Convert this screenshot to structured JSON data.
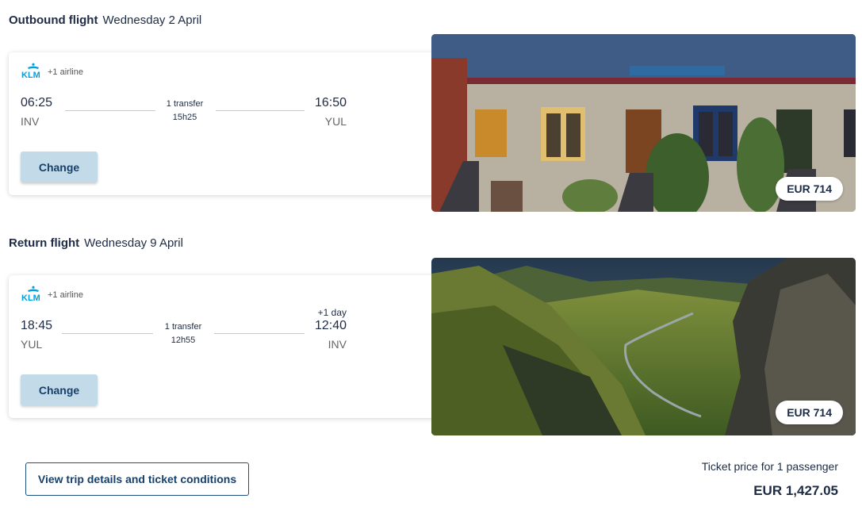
{
  "outbound": {
    "heading": "Outbound flight",
    "date": "Wednesday 2 April",
    "airline_extra": "+1 airline",
    "depart_time": "06:25",
    "depart_code": "INV",
    "transfer_text": "1 transfer",
    "duration": "15h25",
    "arrive_time": "16:50",
    "arrive_code": "YUL",
    "change_label": "Change",
    "price": "EUR 714"
  },
  "return": {
    "heading": "Return flight",
    "date": "Wednesday 9 April",
    "airline_extra": "+1 airline",
    "depart_time": "18:45",
    "depart_code": "YUL",
    "transfer_text": "1 transfer",
    "duration": "12h55",
    "plus_day": "+1 day",
    "arrive_time": "12:40",
    "arrive_code": "INV",
    "change_label": "Change",
    "price": "EUR 714"
  },
  "footer": {
    "details_button": "View trip details and ticket conditions",
    "ticket_label": "Ticket price for 1 passenger",
    "ticket_total": "EUR 1,427.05"
  },
  "colors": {
    "brand_blue": "#00a1de",
    "button_fill": "#c3dbe9",
    "button_text": "#17406a"
  },
  "icons": {
    "airline_logo": "klm-logo"
  }
}
